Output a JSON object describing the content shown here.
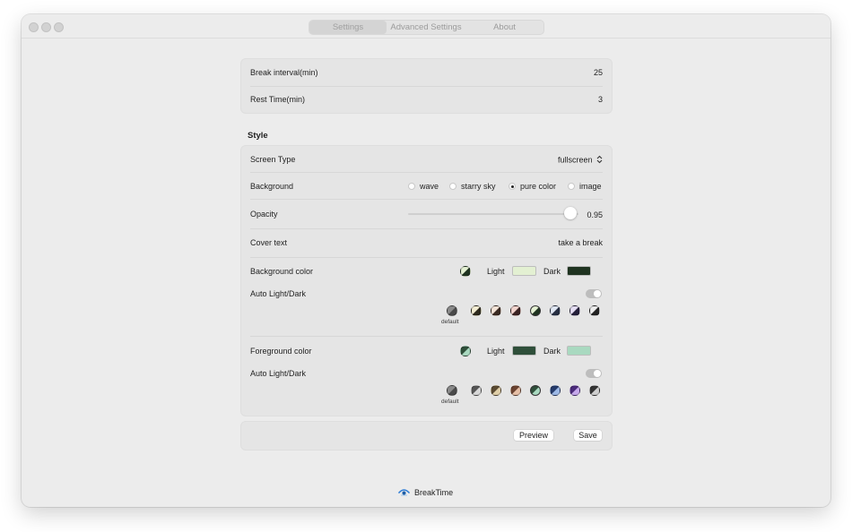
{
  "tabs": [
    "Settings",
    "Advanced Settings",
    "About"
  ],
  "general": {
    "break_interval_label": "Break interval(min)",
    "break_interval_value": "25",
    "rest_time_label": "Rest Time(min)",
    "rest_time_value": "3"
  },
  "style": {
    "title": "Style",
    "screen_type_label": "Screen Type",
    "screen_type_value": "fullscreen",
    "background_label": "Background",
    "background_options": [
      "wave",
      "starry sky",
      "pure color",
      "image"
    ],
    "background_selected": "pure color",
    "opacity_label": "Opacity",
    "opacity_value": "0.95",
    "opacity_fraction": 0.95,
    "cover_text_label": "Cover text",
    "cover_text_value": "take a break",
    "bg_color_label": "Background color",
    "light_label": "Light",
    "dark_label": "Dark",
    "bg_light_color": "#e3f0d2",
    "bg_dark_color": "#1f3320",
    "auto_label": "Auto Light/Dark",
    "default_label": "default",
    "fg_color_label": "Foreground color",
    "fg_light_color": "#2f4f3a",
    "fg_dark_color": "#a9d9c0"
  },
  "actions": {
    "preview_label": "Preview",
    "save_label": "Save"
  },
  "footer": {
    "app_name": "BreakTime",
    "icon": "eye-icon"
  },
  "colors": {
    "window_bg": "#ececec",
    "card_bg": "#e5e5e5"
  }
}
